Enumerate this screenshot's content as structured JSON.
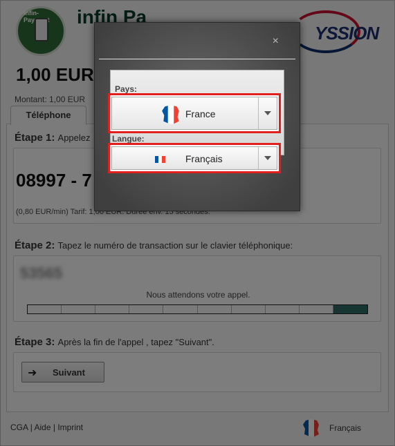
{
  "header": {
    "logo_text": "infin-Payment",
    "brand_text": "infin Pa",
    "partner_text": "YSSION"
  },
  "price": "1,00 EUR",
  "amount_label": "Montant: 1,00 EUR",
  "tab_label": "Téléphone",
  "step1": {
    "label": "Étape 1:",
    "desc": "Appelez",
    "phone_number": "08997 - 7",
    "tariff": "(0,80 EUR/min) Tarif: 1,00 EUR. Durée env. 15 secondes."
  },
  "step2": {
    "label": "Étape 2:",
    "desc": "Tapez le numéro de transaction sur le clavier téléphonique:",
    "code": "53565",
    "waiting": "Nous attendons votre appel.",
    "progress": 0.1
  },
  "step3": {
    "label": "Étape 3:",
    "desc": "Après la fin de l'appel , tapez \"Suivant\".",
    "next_label": "Suivant"
  },
  "footer": {
    "cga": "CGA",
    "sep1": "|",
    "help": "Aide",
    "sep2": "|",
    "imprint": "Imprint",
    "language": "Français"
  },
  "modal": {
    "close_label": "×",
    "country_label": "Pays:",
    "country_value": "France",
    "language_label": "Langue:",
    "language_value": "Français"
  },
  "colors": {
    "highlight_border": "#e41d1d",
    "progress_fill": "#2f6b64",
    "flag_blue": "#0055a4",
    "flag_red": "#ef4135"
  }
}
